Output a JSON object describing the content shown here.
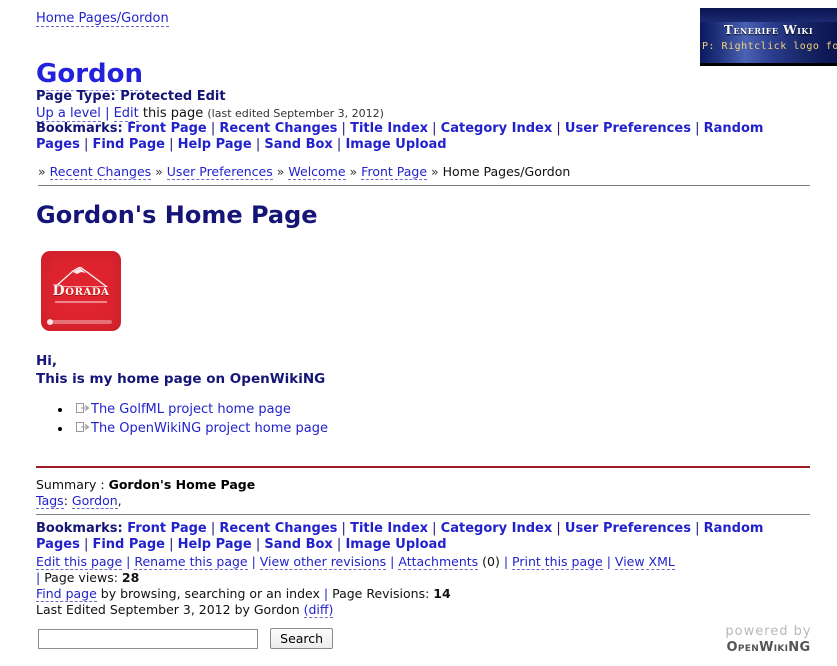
{
  "logo": {
    "title": "Tenerife Wiki",
    "tip": "P: Rightclick logo for men"
  },
  "header": {
    "top_crumb": "Home Pages/Gordon",
    "page_title": "Gordon",
    "page_type": "Page Type: Protected Edit",
    "up_a_level": "Up a level",
    "edit": "Edit",
    "edit_suffix": "this page",
    "last_edited_meta": "(last edited September 3, 2012)"
  },
  "bookmarks": {
    "label": "Bookmarks:",
    "items": [
      "Front Page",
      "Recent Changes",
      "Title Index",
      "Category Index",
      "User Preferences",
      "Random Pages",
      "Find Page",
      "Help Page",
      "Sand Box",
      "Image Upload"
    ]
  },
  "trail": {
    "marker": "»",
    "items": [
      "Recent Changes",
      "User Preferences",
      "Welcome",
      "Front Page"
    ],
    "current": "Home Pages/Gordon"
  },
  "main": {
    "heading": "Gordon's Home Page",
    "image": {
      "alt": "Dorada beer coaster",
      "word": "Dorada",
      "color": "#e0242f"
    },
    "greeting_line1": "Hi,",
    "greeting_line2": "This is my home page on OpenWikiNG",
    "links": [
      "The GolfML project home page",
      "The OpenWikiNG project home page"
    ]
  },
  "footer": {
    "summary_label": "Summary :",
    "summary_value": "Gordon's Home Page",
    "tags_label": "Tags",
    "tags_value": "Gordon",
    "tags_trailing": ",",
    "actions": [
      "Edit this page",
      "Rename this page",
      "View other revisions",
      "Attachments",
      "Print this page",
      "View XML"
    ],
    "attachments_count": "(0)",
    "page_views_label": "Page views:",
    "page_views_value": "28",
    "find_page_link": "Find page",
    "find_page_rest": "by browsing, searching or an index",
    "revisions_label": "Page Revisions:",
    "revisions_value": "14",
    "last_edited": "Last Edited September 3, 2012 by Gordon",
    "diff_link": "(diff)"
  },
  "search": {
    "value": "",
    "placeholder": "",
    "button_label": "Search"
  },
  "powered": {
    "line1": "powered by",
    "line2": "OpenWikiNG"
  }
}
